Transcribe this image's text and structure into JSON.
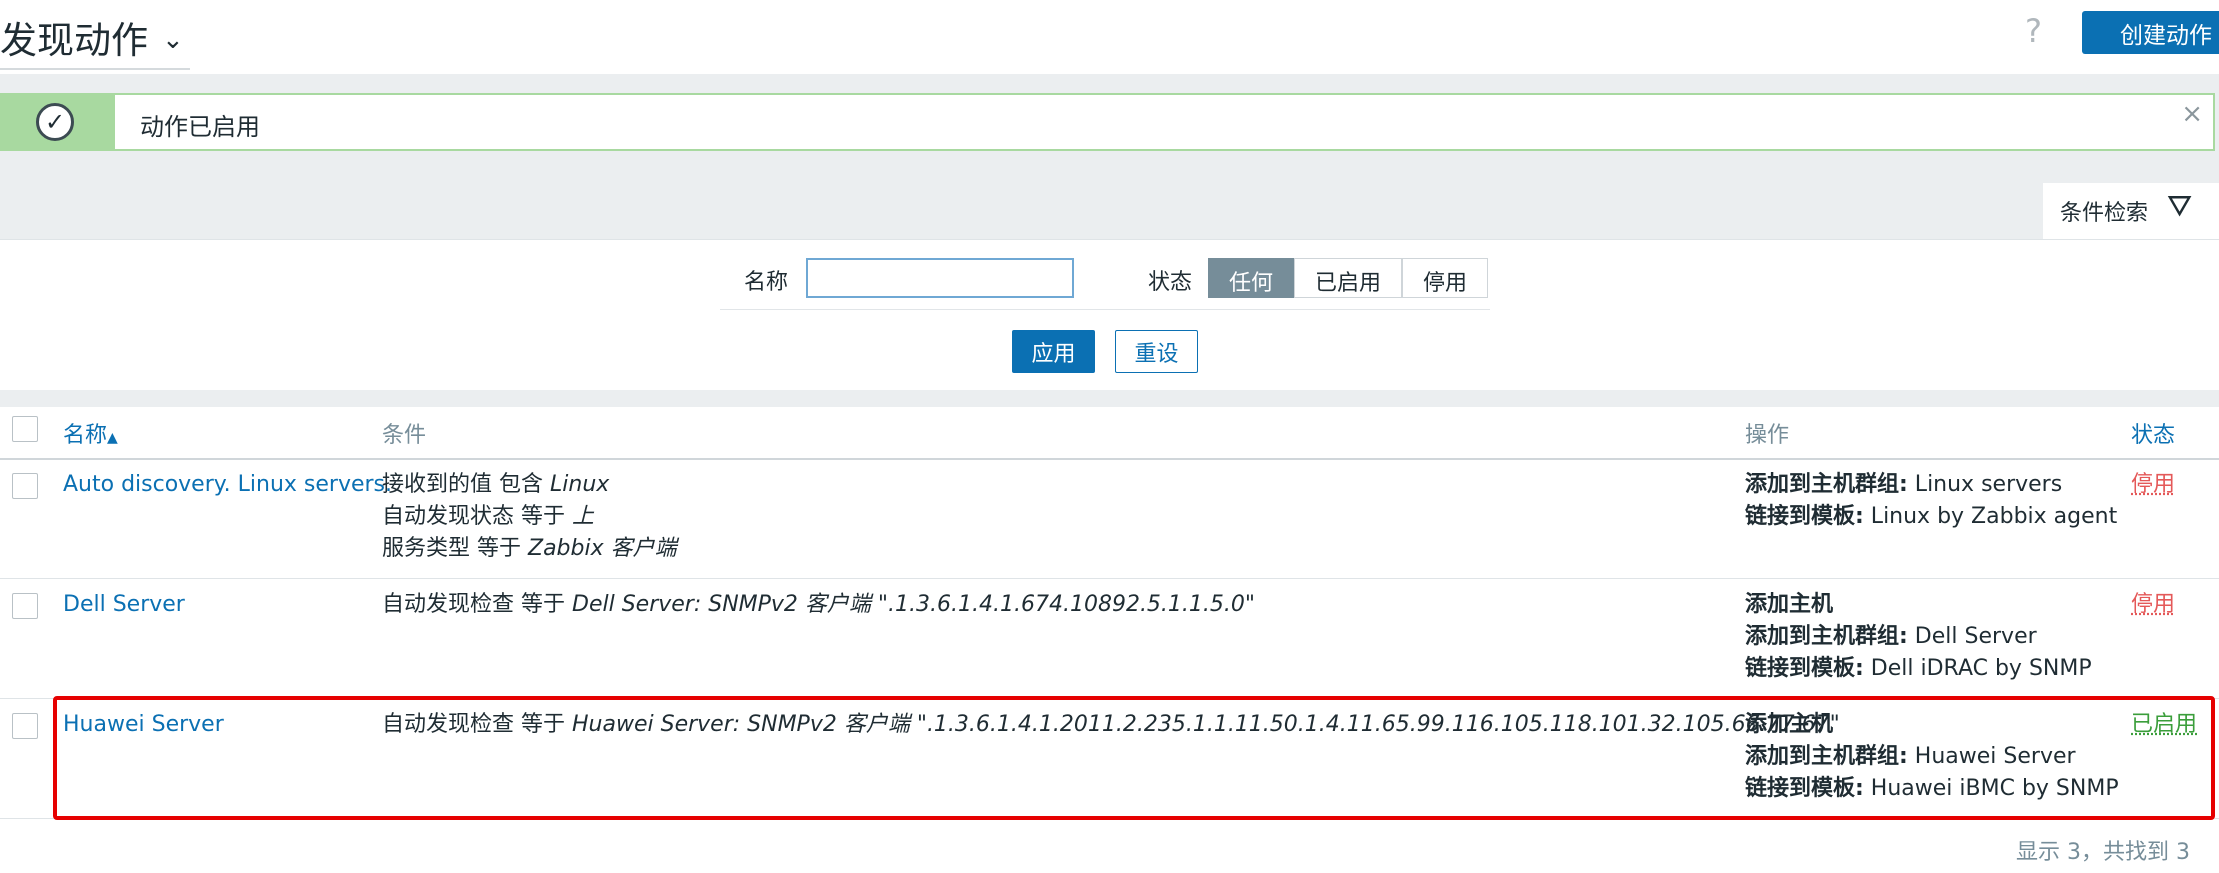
{
  "header": {
    "title": "发现动作",
    "help": "?",
    "create_button": "创建动作"
  },
  "message": {
    "text": "动作已启用",
    "close": "×"
  },
  "filter": {
    "tab_label": "条件检索",
    "name_label": "名称",
    "name_value": "",
    "status_label": "状态",
    "status_options": [
      "任何",
      "已启用",
      "停用"
    ],
    "status_selected": "任何",
    "apply": "应用",
    "reset": "重设"
  },
  "table": {
    "headers": {
      "name": "名称",
      "conditions": "条件",
      "operations": "操作",
      "status": "状态"
    },
    "sort_indicator": "▲",
    "rows": [
      {
        "name": "Auto discovery. Linux servers.",
        "conditions": [
          {
            "prefix": "接收到的值 包含 ",
            "value": "Linux"
          },
          {
            "prefix": "自动发现状态 等于 ",
            "value": "上"
          },
          {
            "prefix": "服务类型 等于 ",
            "value": "Zabbix 客户端"
          }
        ],
        "operations": [
          {
            "label": "添加到主机群组:",
            "value": " Linux servers"
          },
          {
            "label": "链接到模板:",
            "value": " Linux by Zabbix agent"
          }
        ],
        "status": "停用"
      },
      {
        "name": "Dell Server",
        "conditions": [
          {
            "prefix": "自动发现检查 等于 ",
            "value": "Dell Server: SNMPv2 客户端 \".1.3.6.1.4.1.674.10892.5.1.1.5.0\""
          }
        ],
        "operations": [
          {
            "label": "添加主机",
            "value": ""
          },
          {
            "label": "添加到主机群组:",
            "value": " Dell Server"
          },
          {
            "label": "链接到模板:",
            "value": " Dell iDRAC by SNMP"
          }
        ],
        "status": "停用"
      },
      {
        "name": "Huawei Server",
        "conditions": [
          {
            "prefix": "自动发现检查 等于 ",
            "value": "Huawei Server: SNMPv2 客户端 \".1.3.6.1.4.1.2011.2.235.1.1.11.50.1.4.11.65.99.116.105.118.101.32.105.66.77.67\""
          }
        ],
        "operations": [
          {
            "label": "添加主机",
            "value": ""
          },
          {
            "label": "添加到主机群组:",
            "value": " Huawei Server"
          },
          {
            "label": "链接到模板:",
            "value": " Huawei iBMC by SNMP"
          }
        ],
        "status": "已启用"
      }
    ],
    "footer": "显示 3，共找到 3"
  }
}
